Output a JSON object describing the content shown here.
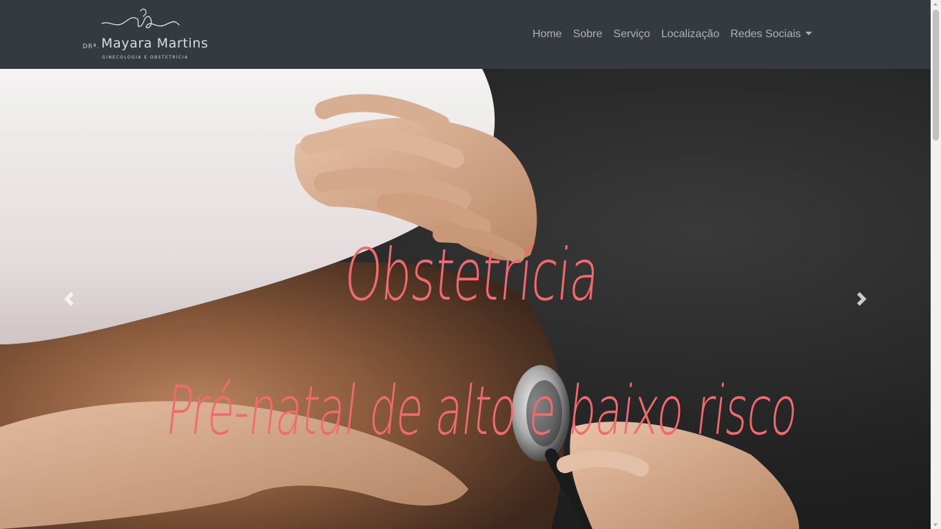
{
  "navbar": {
    "brand": {
      "prefix": "DRª.",
      "name": "Mayara Martins",
      "subtitle": "GINECOLOGIA E OBSTETRÍCIA"
    },
    "links": [
      {
        "label": "Home"
      },
      {
        "label": "Sobre"
      },
      {
        "label": "Serviço"
      },
      {
        "label": "Localização"
      },
      {
        "label": "Redes Sociais"
      }
    ]
  },
  "carousel": {
    "slide": {
      "title": "Obstetrícia",
      "subtitle": "Pré-natal de alto e baixo risco"
    },
    "controls": {
      "prev_icon": "chevron-left-icon",
      "next_icon": "chevron-right-icon"
    }
  },
  "colors": {
    "navbar_bg": "#343a40",
    "caption": "#f06b6d",
    "nav_link": "rgba(255,255,255,0.6)"
  }
}
